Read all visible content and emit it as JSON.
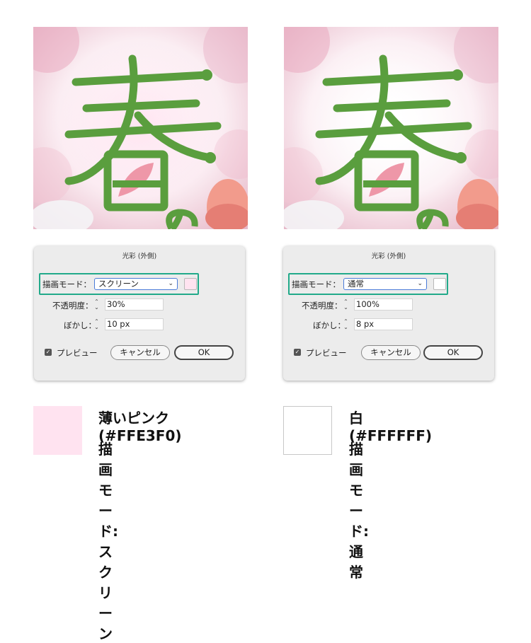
{
  "panels": [
    {
      "photo_glyph": "春",
      "photo_glyph_small": "の",
      "dialog": {
        "title": "光彩 (外側)",
        "mode_label": "描画モード：",
        "mode_value": "スクリーン",
        "opacity_label": "不透明度：",
        "opacity_value": "30%",
        "blur_label": "ぼかし：",
        "blur_value": "10 px",
        "preview_label": "プレビュー",
        "cancel_label": "キャンセル",
        "ok_label": "OK",
        "swatch_color": "#FFE3F0"
      },
      "legend": {
        "color_text": "薄いピンク(#FFE3F0)",
        "mode_text": "描画モード:スクリーン",
        "swatch_color": "#FFE3F0"
      }
    },
    {
      "photo_glyph": "春",
      "photo_glyph_small": "の",
      "dialog": {
        "title": "光彩 (外側)",
        "mode_label": "描画モード：",
        "mode_value": "通常",
        "opacity_label": "不透明度：",
        "opacity_value": "100%",
        "blur_label": "ぼかし：",
        "blur_value": "8 px",
        "preview_label": "プレビュー",
        "cancel_label": "キャンセル",
        "ok_label": "OK",
        "swatch_color": "#FFFFFF"
      },
      "legend": {
        "color_text": "白(#FFFFFF)",
        "mode_text": "描画モード:通常",
        "swatch_color": "#FFFFFF"
      }
    }
  ],
  "colors": {
    "highlight": "#22aa8a",
    "kanji_green": "#5a9e3e",
    "petal_pink": "#ee97a8"
  },
  "icons": {
    "stepper": "up-down-stepper-icon",
    "checkbox": "checkmark-icon",
    "dropdown": "chevron-down-icon"
  }
}
